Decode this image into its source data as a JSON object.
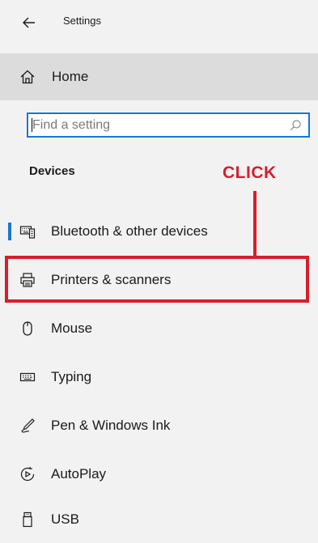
{
  "window": {
    "title": "Settings"
  },
  "home": {
    "label": "Home"
  },
  "search": {
    "placeholder": "Find a setting"
  },
  "section": {
    "title": "Devices"
  },
  "annotation": {
    "text": "CLICK",
    "color": "#d61f2c"
  },
  "accent": "#1976d2",
  "nav": {
    "items": [
      {
        "label": "Bluetooth & other devices",
        "icon": "bluetooth-devices-icon",
        "selected": true
      },
      {
        "label": "Printers & scanners",
        "icon": "printer-icon",
        "selected": false
      },
      {
        "label": "Mouse",
        "icon": "mouse-icon",
        "selected": false
      },
      {
        "label": "Typing",
        "icon": "keyboard-icon",
        "selected": false
      },
      {
        "label": "Pen & Windows Ink",
        "icon": "pen-icon",
        "selected": false
      },
      {
        "label": "AutoPlay",
        "icon": "autoplay-icon",
        "selected": false
      },
      {
        "label": "USB",
        "icon": "usb-icon",
        "selected": false
      }
    ]
  }
}
